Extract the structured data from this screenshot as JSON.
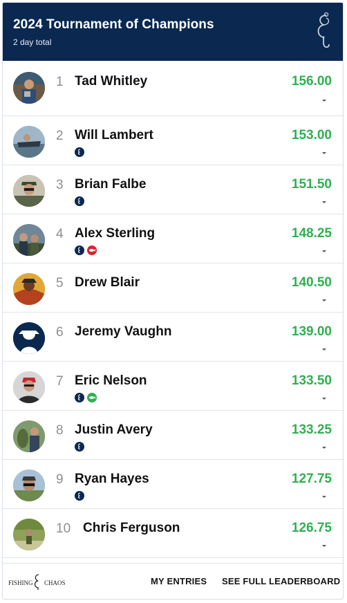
{
  "header": {
    "title": "2024 Tournament of Champions",
    "subtitle": "2 day total",
    "logo_icon": "fishing-hook-logo-icon",
    "background": "#0a2850"
  },
  "leaderboard": {
    "score_color": "#2fb050",
    "rows": [
      {
        "rank": "1",
        "name": "Tad Whitley",
        "score": "156.00",
        "badges": []
      },
      {
        "rank": "2",
        "name": "Will Lambert",
        "score": "153.00",
        "badges": [
          "hook-badge-icon"
        ]
      },
      {
        "rank": "3",
        "name": "Brian Falbe",
        "score": "151.50",
        "badges": [
          "hook-badge-icon"
        ]
      },
      {
        "rank": "4",
        "name": "Alex Sterling",
        "score": "148.25",
        "badges": [
          "hook-badge-icon",
          "red-fish-badge-icon"
        ]
      },
      {
        "rank": "5",
        "name": "Drew Blair",
        "score": "140.50",
        "badges": []
      },
      {
        "rank": "6",
        "name": "Jeremy Vaughn",
        "score": "139.00",
        "badges": []
      },
      {
        "rank": "7",
        "name": "Eric Nelson",
        "score": "133.50",
        "badges": [
          "hook-badge-icon",
          "green-fish-badge-icon"
        ]
      },
      {
        "rank": "8",
        "name": "Justin Avery",
        "score": "133.25",
        "badges": [
          "hook-badge-icon"
        ]
      },
      {
        "rank": "9",
        "name": "Ryan Hayes",
        "score": "127.75",
        "badges": [
          "hook-badge-icon"
        ]
      },
      {
        "rank": "10",
        "name": "Chris Ferguson",
        "score": "126.75",
        "badges": []
      }
    ]
  },
  "footer": {
    "brand_icon": "fishing-and-chaos-logo-icon",
    "my_entries": "MY ENTRIES",
    "see_full": "SEE FULL LEADERBOARD"
  }
}
